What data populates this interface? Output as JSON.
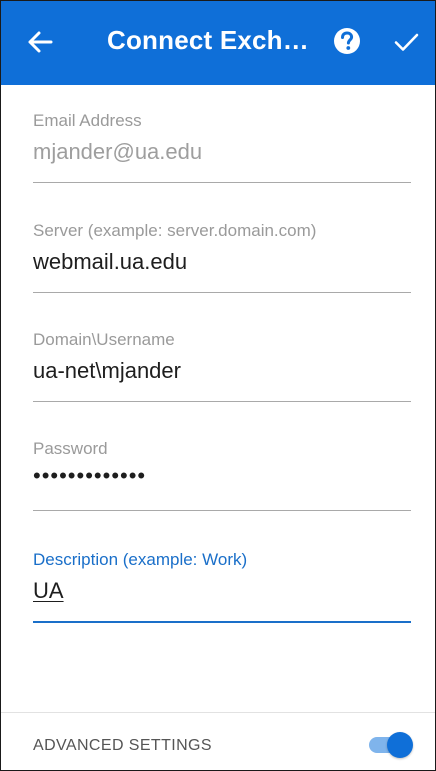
{
  "header": {
    "title": "Connect Exch…",
    "back_icon": "arrow-left-icon",
    "help_icon": "help-circle-icon",
    "confirm_icon": "checkmark-icon",
    "background_color": "#0f6fd8"
  },
  "form": {
    "email": {
      "label": "Email Address",
      "value": "mjander@ua.edu"
    },
    "server": {
      "label": "Server (example: server.domain.com)",
      "value": "webmail.ua.edu"
    },
    "username": {
      "label": "Domain\\Username",
      "value": "ua-net\\mjander"
    },
    "password": {
      "label": "Password",
      "value": "•••••••••••••"
    },
    "description": {
      "label": "Description (example: Work)",
      "value": "UA"
    }
  },
  "advanced_settings": {
    "label": "ADVANCED SETTINGS",
    "enabled": true
  },
  "colors": {
    "accent": "#1a6fc9",
    "toggle_on": "#0f6fd8"
  }
}
